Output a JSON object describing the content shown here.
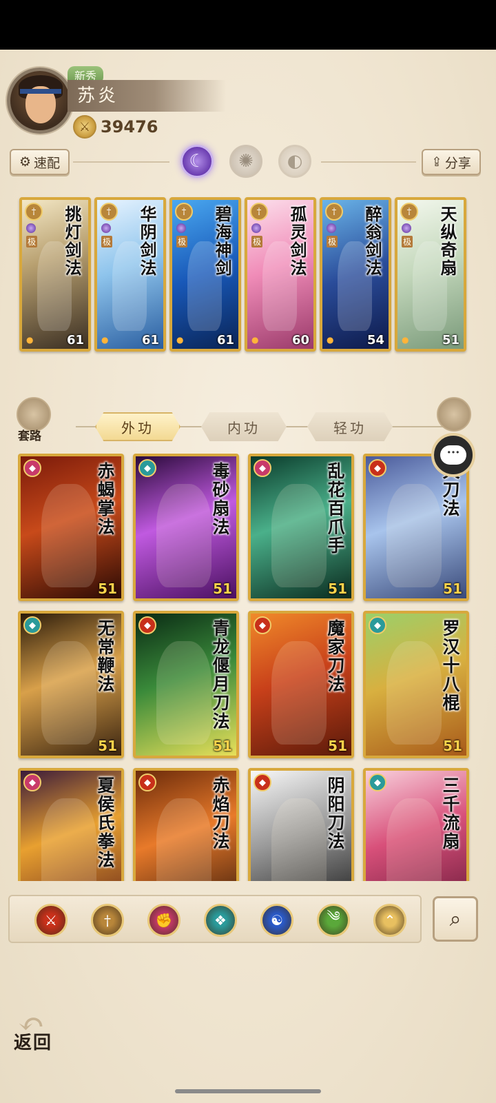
{
  "player": {
    "rank_badge": "新秀",
    "name": "苏炎",
    "power": "39476"
  },
  "header": {
    "quick_config_label": "速配",
    "share_label": "分享",
    "tab_icons": [
      "moon-icon",
      "sun-icon",
      "crescent-icon"
    ]
  },
  "equipped_cards": [
    {
      "name": "挑灯剑法",
      "level": "61",
      "grade": "极",
      "bg": "bg-gold"
    },
    {
      "name": "华阴剑法",
      "level": "61",
      "grade": "极",
      "bg": "bg-ice"
    },
    {
      "name": "碧海神剑",
      "level": "61",
      "grade": "极",
      "bg": "bg-blue"
    },
    {
      "name": "孤灵剑法",
      "level": "60",
      "grade": "极",
      "bg": "bg-pink"
    },
    {
      "name": "醉翁剑法",
      "level": "54",
      "grade": "极",
      "bg": "bg-navy"
    },
    {
      "name": "天纵奇扇",
      "level": "51",
      "grade": "极",
      "bg": "bg-mist"
    }
  ],
  "categories": {
    "left_label": "套路",
    "tabs": [
      "外功",
      "内功",
      "轻功"
    ],
    "active_tab": "外功"
  },
  "skill_cards": [
    {
      "name": "赤蝎掌法",
      "level": "51",
      "bg": "bg-red",
      "icon_color": "#c83a6a"
    },
    {
      "name": "毒砂扇法",
      "level": "51",
      "bg": "bg-violet",
      "icon_color": "#2a9a9a"
    },
    {
      "name": "乱花百爪手",
      "level": "51",
      "bg": "bg-green",
      "icon_color": "#c83a6a"
    },
    {
      "name": "天刀法",
      "level": "51",
      "bg": "bg-sky",
      "icon_color": "#c8301a"
    },
    {
      "name": "无常鞭法",
      "level": "51",
      "bg": "bg-amber",
      "icon_color": "#2a9a9a"
    },
    {
      "name": "青龙偃月刀法",
      "level": "51",
      "bg": "bg-jade",
      "icon_color": "#c8301a"
    },
    {
      "name": "魔家刀法",
      "level": "51",
      "bg": "bg-fire",
      "icon_color": "#c8301a"
    },
    {
      "name": "罗汉十八棍",
      "level": "51",
      "bg": "bg-lime",
      "icon_color": "#2a9a9a"
    },
    {
      "name": "夏侯氏拳法",
      "level": "",
      "bg": "bg-dusk",
      "icon_color": "#c83a6a"
    },
    {
      "name": "赤焰刀法",
      "level": "",
      "bg": "bg-ember",
      "icon_color": "#c8301a"
    },
    {
      "name": "阴阳刀法",
      "level": "",
      "bg": "bg-yinyang",
      "icon_color": "#c8301a"
    },
    {
      "name": "三千流扇",
      "level": "",
      "bg": "bg-rose",
      "icon_color": "#2a9a9a"
    }
  ],
  "filters": [
    {
      "icon": "blade-filter-icon",
      "color": "#c8301a"
    },
    {
      "icon": "sword-filter-icon",
      "color": "#b8863a"
    },
    {
      "icon": "fist-filter-icon",
      "color": "#c83a6a"
    },
    {
      "icon": "fan-filter-icon",
      "color": "#2a9a9a"
    },
    {
      "icon": "taiji-filter-icon",
      "color": "#2a5ac8"
    },
    {
      "icon": "whip-filter-icon",
      "color": "#5aa83a"
    },
    {
      "icon": "misc-filter-icon",
      "color": "#e8c060"
    }
  ],
  "footer": {
    "back_label": "返回"
  }
}
